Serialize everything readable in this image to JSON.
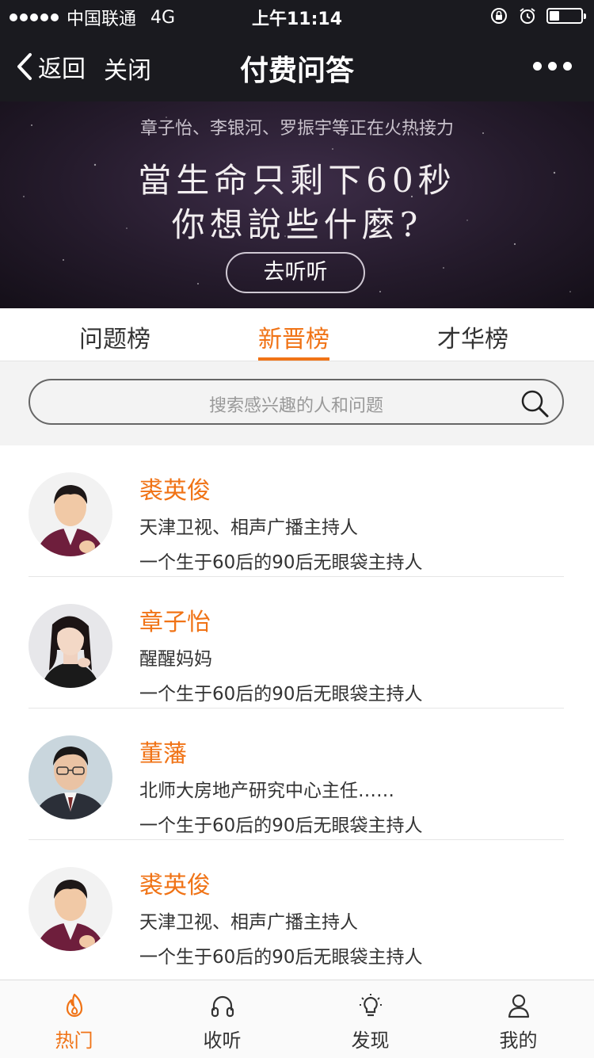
{
  "status_bar": {
    "carrier": "中国联通",
    "network": "4G",
    "time": "上午11:14"
  },
  "nav": {
    "back_label": "返回",
    "close_label": "关闭",
    "title": "付费问答",
    "more_icon": "more-dots-icon"
  },
  "banner": {
    "subtitle": "章子怡、李银河、罗振宇等正在火热接力",
    "headline_line1": "當生命只剩下60秒",
    "headline_line2": "你想說些什麼?",
    "button_label": "去听听"
  },
  "tabs": [
    {
      "label": "问题榜",
      "active": false
    },
    {
      "label": "新晋榜",
      "active": true
    },
    {
      "label": "才华榜",
      "active": false
    }
  ],
  "search": {
    "placeholder": "搜索感兴趣的人和问题"
  },
  "people": [
    {
      "name": "裘英俊",
      "title": "天津卫视、相声广播主持人",
      "intro": "一个生于60后的90后无眼袋主持人"
    },
    {
      "name": "章子怡",
      "title": "醒醒妈妈",
      "intro": "一个生于60后的90后无眼袋主持人"
    },
    {
      "name": "董藩",
      "title": "北师大房地产研究中心主任……",
      "intro": "一个生于60后的90后无眼袋主持人"
    },
    {
      "name": "裘英俊",
      "title": "天津卫视、相声广播主持人",
      "intro": "一个生于60后的90后无眼袋主持人"
    }
  ],
  "tabbar": [
    {
      "label": "热门",
      "icon": "flame-icon",
      "active": true
    },
    {
      "label": "收听",
      "icon": "headphones-icon",
      "active": false
    },
    {
      "label": "发现",
      "icon": "lightbulb-icon",
      "active": false
    },
    {
      "label": "我的",
      "icon": "person-icon",
      "active": false
    }
  ],
  "colors": {
    "accent": "#f07316",
    "dark_bar": "#1a1a1f",
    "text": "#333333"
  }
}
